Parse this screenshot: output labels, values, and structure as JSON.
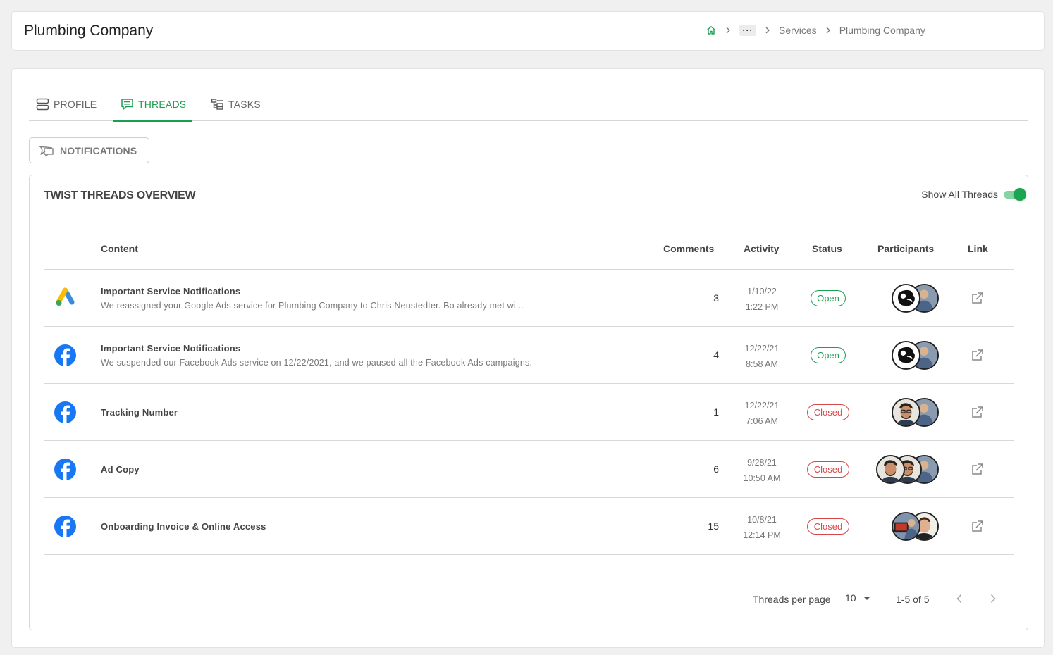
{
  "header": {
    "title": "Plumbing Company",
    "breadcrumb": {
      "more": "···",
      "services": "Services",
      "current": "Plumbing Company"
    }
  },
  "tabs": [
    {
      "label": "PROFILE",
      "icon": "profile-icon"
    },
    {
      "label": "THREADS",
      "icon": "threads-icon",
      "active": true
    },
    {
      "label": "TASKS",
      "icon": "tasks-icon"
    }
  ],
  "notifications_button": "NOTIFICATIONS",
  "threads": {
    "title": "TWIST THREADS OVERVIEW",
    "toggle_label": "Show All Threads",
    "toggle_on": true,
    "columns": {
      "content": "Content",
      "comments": "Comments",
      "activity": "Activity",
      "status": "Status",
      "participants": "Participants",
      "link": "Link"
    },
    "rows": [
      {
        "source_icon": "google-ads-icon",
        "title": "Important Service Notifications",
        "subtitle": "We reassigned your Google Ads service for  Plumbing Company to Chris Neustedter. Bo already met wi...",
        "comments": "3",
        "date": "1/10/22",
        "time": "1:22 PM",
        "status": "Open"
      },
      {
        "source_icon": "facebook-icon",
        "title": "Important Service Notifications",
        "subtitle": "We suspended our Facebook Ads service on 12/22/2021, and we paused all the Facebook Ads campaigns.",
        "comments": "4",
        "date": "12/22/21",
        "time": "8:58 AM",
        "status": "Open"
      },
      {
        "source_icon": "facebook-icon",
        "title": "Tracking Number",
        "subtitle": "",
        "comments": "1",
        "date": "12/22/21",
        "time": "7:06 AM",
        "status": "Closed"
      },
      {
        "source_icon": "facebook-icon",
        "title": "Ad Copy",
        "subtitle": "",
        "comments": "6",
        "date": "9/28/21",
        "time": "10:50 AM",
        "status": "Closed"
      },
      {
        "source_icon": "facebook-icon",
        "title": "Onboarding Invoice & Online Access",
        "subtitle": "",
        "comments": "15",
        "date": "10/8/21",
        "time": "12:14 PM",
        "status": "Closed"
      }
    ],
    "pagination": {
      "per_page_label": "Threads per page",
      "per_page_value": "10",
      "range": "1-5 of 5"
    }
  },
  "colors": {
    "accent_green": "#1a9e4f",
    "closed_red": "#d94848",
    "facebook_blue": "#1877f2"
  }
}
